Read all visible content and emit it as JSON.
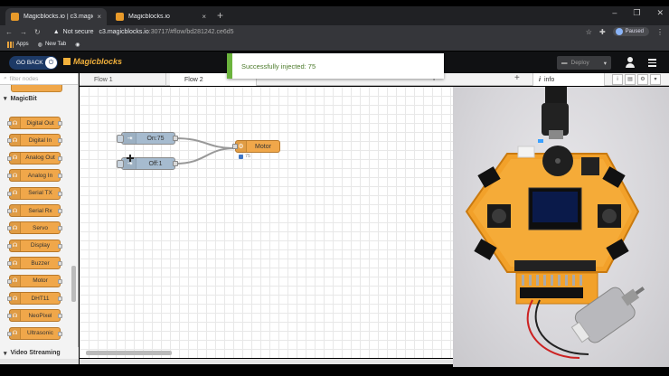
{
  "browser": {
    "tabs": [
      {
        "title": "Magicblocks.io | c3.magicblocks.i",
        "close": "×"
      },
      {
        "title": "Magicblocks.io",
        "close": "×"
      }
    ],
    "new_tab": "+",
    "window_controls": {
      "minimize": "–",
      "maximize": "❐",
      "close": "✕"
    },
    "security_text": "Not secure",
    "url_host": "c3.magicblocks.io",
    "url_path": ":30717/#flow/bd281242.ce6d5",
    "profile_label": "Paused",
    "bookmarks": [
      {
        "label": "Apps"
      },
      {
        "label": "New Tab"
      }
    ]
  },
  "app": {
    "go_back_label": "GO BACK",
    "logo_text": "Magicblocks",
    "deploy_label": "Deploy",
    "toast_message": "Successfully injected: 75"
  },
  "palette": {
    "filter_placeholder": "filter nodes",
    "category": "MagicBit",
    "nodes": [
      "Digital Out",
      "Digital In",
      "Analog Out",
      "Analog In",
      "Serial TX",
      "Serial Rx",
      "Servo",
      "Display",
      "Buzzer",
      "Motor",
      "DHT11",
      "NeoPixel",
      "Ultrasonic"
    ],
    "next_category": "Video Streaming"
  },
  "workspace": {
    "tabs": [
      {
        "label": "Flow 1"
      },
      {
        "label": "Flow 2"
      }
    ],
    "add_flow": "+",
    "flow_nodes": [
      {
        "type": "inject",
        "label": "On:75"
      },
      {
        "type": "inject",
        "label": "Off:1"
      },
      {
        "type": "motor",
        "label": "Motor",
        "status": "75"
      }
    ]
  },
  "sidebar": {
    "tab_label": "info",
    "tab_icon": "i"
  },
  "colors": {
    "node_orange": "#f0a74a",
    "inject_blue": "#a6bbcf",
    "toast_green": "#6bb33d",
    "status_blue": "#3f76c5"
  }
}
